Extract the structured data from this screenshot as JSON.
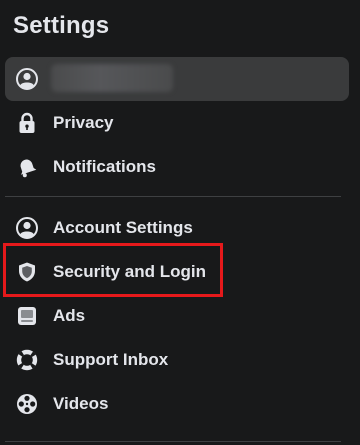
{
  "page": {
    "title": "Settings"
  },
  "profile": {
    "name_hidden": true
  },
  "menu": {
    "privacy": "Privacy",
    "notifications": "Notifications",
    "account_settings": "Account Settings",
    "security_login": "Security and Login",
    "ads": "Ads",
    "support_inbox": "Support Inbox",
    "videos": "Videos"
  },
  "colors": {
    "background": "#18191a",
    "profile_row": "#3a3b3c",
    "text": "#e4e6eb",
    "highlight": "#e5191b",
    "divider": "#3e4042"
  },
  "icons": {
    "profile": "person-circle-icon",
    "privacy": "lock-icon",
    "notifications": "bell-icon",
    "account_settings": "person-circle-icon",
    "security_login": "shield-icon",
    "ads": "ads-icon",
    "support_inbox": "lifebuoy-icon",
    "videos": "film-reel-icon"
  }
}
